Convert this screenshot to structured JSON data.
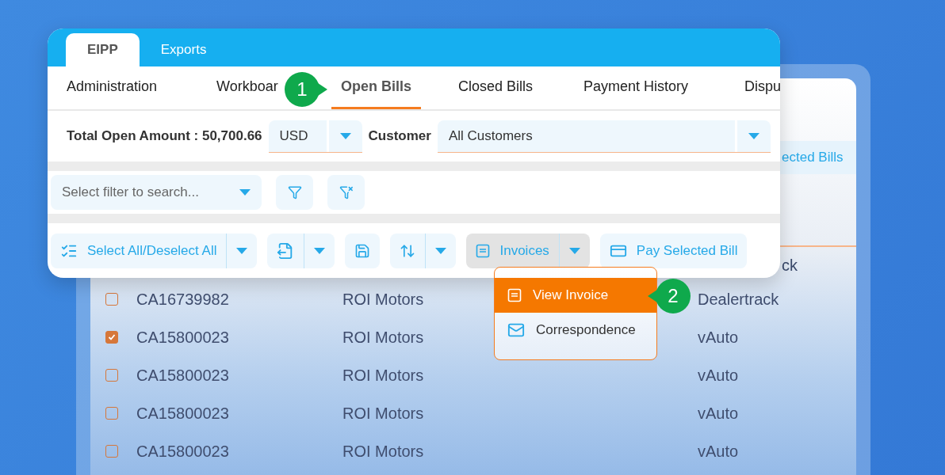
{
  "background_table": {
    "button": "ected Bills",
    "partial_cell": "ck",
    "rows": [
      {
        "checked": false,
        "invoice": "CA16739982",
        "customer": "ROI Motors",
        "column_3": "Dealertrack"
      },
      {
        "checked": true,
        "invoice": "CA15800023",
        "customer": "ROI Motors",
        "column_3": "vAuto"
      },
      {
        "checked": false,
        "invoice": "CA15800023",
        "customer": "ROI Motors",
        "column_3": "vAuto"
      },
      {
        "checked": false,
        "invoice": "CA15800023",
        "customer": "ROI Motors",
        "column_3": "vAuto"
      },
      {
        "checked": false,
        "invoice": "CA15800023",
        "customer": "ROI Motors",
        "column_3": "vAuto"
      }
    ]
  },
  "panel": {
    "tabs": [
      {
        "label": "EIPP",
        "selected": true
      },
      {
        "label": "Exports",
        "selected": false
      }
    ],
    "nav": [
      {
        "label": "Administration",
        "selected": false
      },
      {
        "label": "Workboar",
        "selected": false
      },
      {
        "label": "Open Bills",
        "selected": true
      },
      {
        "label": "Closed Bills",
        "selected": false
      },
      {
        "label": "Payment History",
        "selected": false
      },
      {
        "label": "Dispu",
        "selected": false
      }
    ],
    "summary": {
      "label": "Total Open Amount : 50,700.66",
      "currency": "USD",
      "customer_label": "Customer",
      "customer_value": "All Customers"
    },
    "filter": {
      "placeholder": "Select filter to search..."
    },
    "toolbar": [
      {
        "kind": "select",
        "label": "Select All/Deselect All",
        "dropdown": true,
        "expanded": false
      },
      {
        "kind": "export",
        "dropdown": true,
        "expanded": false
      },
      {
        "kind": "save",
        "dropdown": false,
        "expanded": false
      },
      {
        "kind": "sort",
        "dropdown": true,
        "expanded": false
      },
      {
        "kind": "invoices",
        "label": "Invoices",
        "dropdown": true,
        "expanded": true
      },
      {
        "kind": "pay",
        "label": "Pay Selected Bill",
        "dropdown": false,
        "expanded": false
      }
    ]
  },
  "menu": [
    {
      "label": "View Invoice",
      "selected": true
    },
    {
      "label": "Correspondence",
      "selected": false
    }
  ],
  "callouts": [
    "1",
    "2"
  ]
}
